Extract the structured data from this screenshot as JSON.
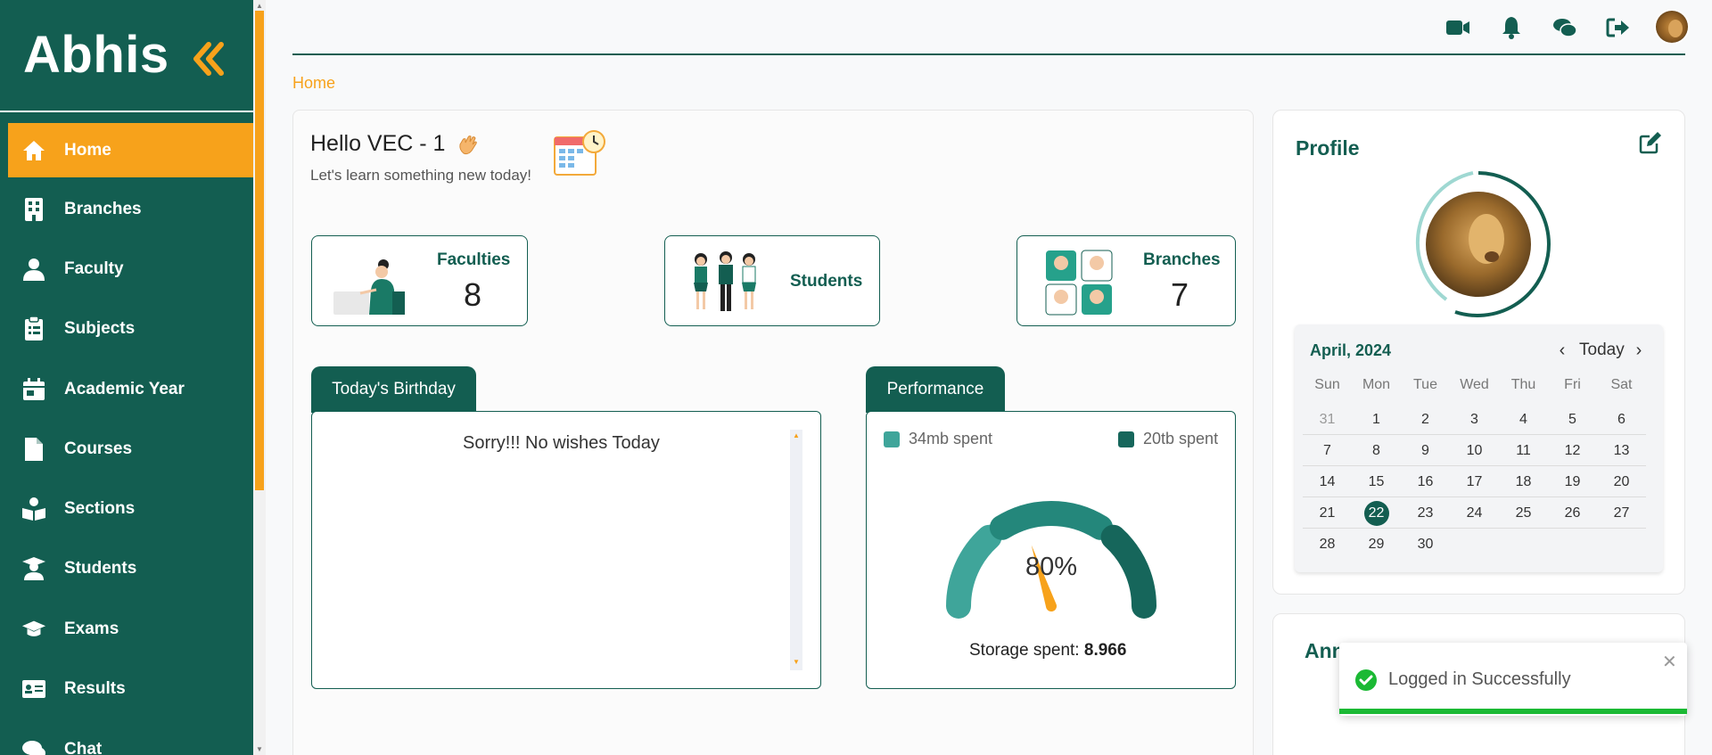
{
  "brand": {
    "logo_text": "Abhis"
  },
  "sidebar": {
    "items": [
      {
        "label": "Home",
        "icon": "home-icon",
        "active": true
      },
      {
        "label": "Branches",
        "icon": "building-icon"
      },
      {
        "label": "Faculty",
        "icon": "user-icon"
      },
      {
        "label": "Subjects",
        "icon": "clipboard-icon"
      },
      {
        "label": "Academic Year",
        "icon": "calendar-icon"
      },
      {
        "label": "Courses",
        "icon": "file-icon"
      },
      {
        "label": "Sections",
        "icon": "reader-icon"
      },
      {
        "label": "Students",
        "icon": "graduate-icon"
      },
      {
        "label": "Exams",
        "icon": "mortarboard-icon"
      },
      {
        "label": "Results",
        "icon": "id-card-icon"
      },
      {
        "label": "Chat",
        "icon": "chat-icon"
      }
    ]
  },
  "topbar": {
    "icons": [
      "video-icon",
      "bell-icon",
      "chat-bubbles-icon",
      "logout-icon",
      "user-avatar"
    ]
  },
  "breadcrumb": "Home",
  "welcome": {
    "greeting": "Hello VEC - 1",
    "subtitle": "Let's learn something new today!"
  },
  "stats": {
    "faculties": {
      "label": "Faculties",
      "value": "8"
    },
    "students": {
      "label": "Students"
    },
    "branches": {
      "label": "Branches",
      "value": "7"
    }
  },
  "birthday": {
    "tab": "Today's Birthday",
    "message": "Sorry!!! No wishes Today"
  },
  "performance": {
    "tab": "Performance",
    "legend_left": "34mb spent",
    "legend_right": "20tb spent",
    "gauge_percent": "80%",
    "gauge_value": 0.8,
    "storage_label": "Storage spent:",
    "storage_value": "8.966"
  },
  "profile": {
    "title": "Profile",
    "calendar": {
      "month_label": "April, 2024",
      "today_label": "Today",
      "dow": [
        "Sun",
        "Mon",
        "Tue",
        "Wed",
        "Thu",
        "Fri",
        "Sat"
      ],
      "weeks": [
        [
          "31",
          "1",
          "2",
          "3",
          "4",
          "5",
          "6"
        ],
        [
          "7",
          "8",
          "9",
          "10",
          "11",
          "12",
          "13"
        ],
        [
          "14",
          "15",
          "16",
          "17",
          "18",
          "19",
          "20"
        ],
        [
          "21",
          "22",
          "23",
          "24",
          "25",
          "26",
          "27"
        ],
        [
          "28",
          "29",
          "30",
          "",
          "",
          "",
          ""
        ]
      ],
      "selected": "22"
    }
  },
  "announcements": {
    "title": "Ann"
  },
  "toast": {
    "message": "Logged in Successfully"
  },
  "colors": {
    "primary": "#135e51",
    "accent": "#f7a21b",
    "success": "#1bb934",
    "gauge_light": "#3fa59a",
    "gauge_mid": "#24877b",
    "gauge_dark": "#16665b"
  }
}
